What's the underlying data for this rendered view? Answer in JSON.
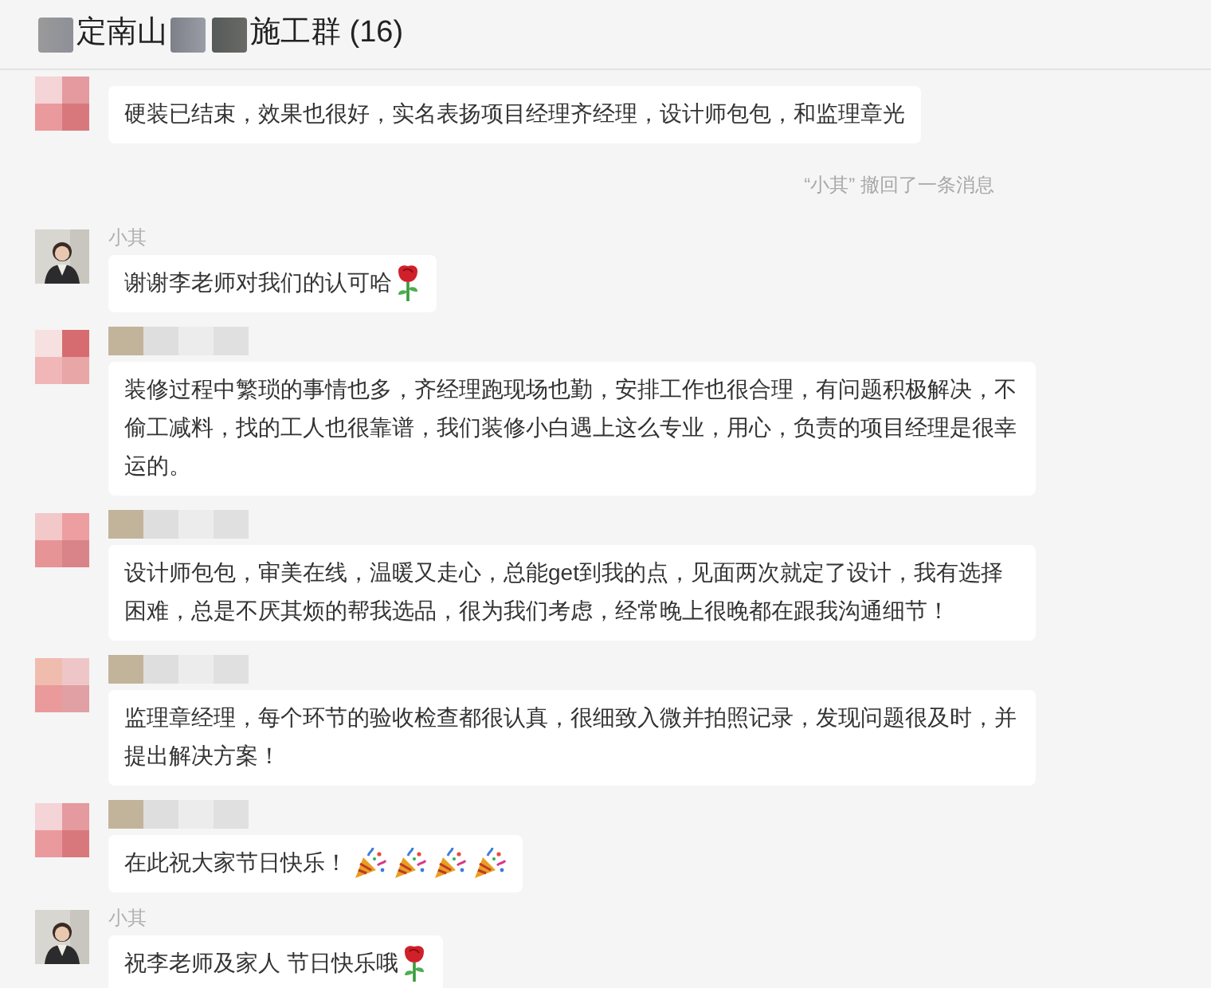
{
  "header": {
    "title_parts": [
      {
        "kind": "mosaic"
      },
      {
        "kind": "text",
        "text": "定南山"
      },
      {
        "kind": "mosaic"
      },
      {
        "kind": "mosaic"
      },
      {
        "kind": "text",
        "text": "施工群 (16)"
      }
    ]
  },
  "messages": [
    {
      "kind": "text",
      "avatar": {
        "kind": "mosaic"
      },
      "sender": {
        "kind": "hidden"
      },
      "text": "硬装已结束，效果也很好，实名表扬项目经理齐经理，设计师包包，和监理章光"
    },
    {
      "kind": "system",
      "text": "“小其” 撤回了一条消息"
    },
    {
      "kind": "text",
      "avatar": {
        "kind": "photo"
      },
      "sender": {
        "kind": "name",
        "name": "小其"
      },
      "text": "谢谢李老师对我们的认可哈",
      "emojis": [
        {
          "kind": "rose"
        }
      ]
    },
    {
      "kind": "text",
      "avatar": {
        "kind": "mosaic"
      },
      "sender": {
        "kind": "mosaic"
      },
      "text": "装修过程中繁琐的事情也多，齐经理跑现场也勤，安排工作也很合理，有问题积极解决，不偷工减料，找的工人也很靠谱，我们装修小白遇上这么专业，用心，负责的项目经理是很幸运的。"
    },
    {
      "kind": "text",
      "avatar": {
        "kind": "mosaic"
      },
      "sender": {
        "kind": "mosaic"
      },
      "text": "设计师包包，审美在线，温暖又走心，总能get到我的点，见面两次就定了设计，我有选择困难，总是不厌其烦的帮我选品，很为我们考虑，经常晚上很晚都在跟我沟通细节！"
    },
    {
      "kind": "text",
      "avatar": {
        "kind": "mosaic"
      },
      "sender": {
        "kind": "mosaic"
      },
      "text": "监理章经理，每个环节的验收检查都很认真，很细致入微并拍照记录，发现问题很及时，并提出解决方案！"
    },
    {
      "kind": "text",
      "avatar": {
        "kind": "mosaic"
      },
      "sender": {
        "kind": "mosaic"
      },
      "text": "在此祝大家节日快乐！",
      "emojis": [
        {
          "kind": "party"
        },
        {
          "kind": "party"
        },
        {
          "kind": "party"
        },
        {
          "kind": "party"
        }
      ]
    },
    {
      "kind": "text",
      "avatar": {
        "kind": "photo"
      },
      "sender": {
        "kind": "name",
        "name": "小其"
      },
      "text": "祝李老师及家人 节日快乐哦",
      "emojis": [
        {
          "kind": "rose"
        }
      ]
    }
  ]
}
